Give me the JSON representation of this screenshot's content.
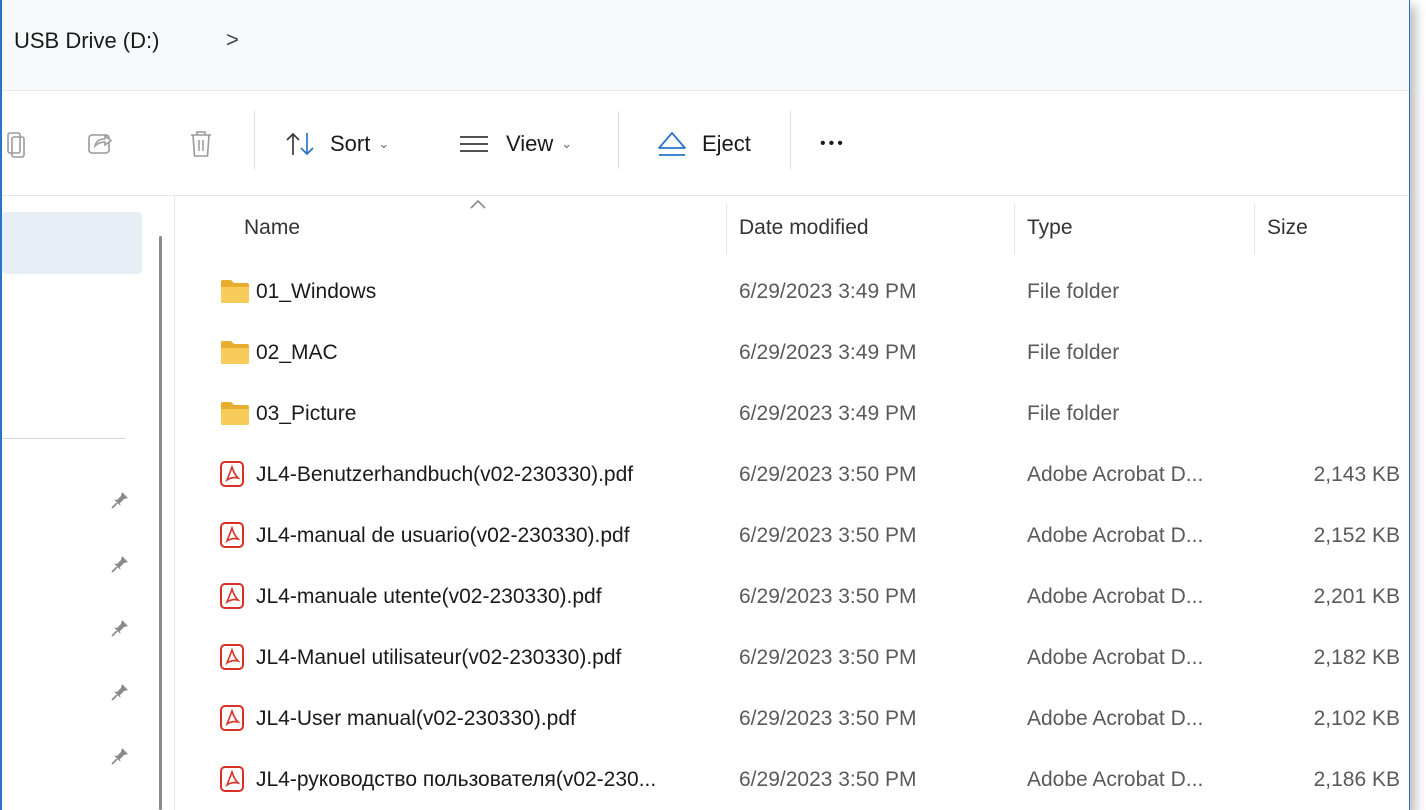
{
  "address": {
    "path": "USB Drive (D:)",
    "chevron": ">"
  },
  "toolbar": {
    "sort_label": "Sort",
    "view_label": "View",
    "eject_label": "Eject",
    "more_label": "•••"
  },
  "columns": {
    "name": "Name",
    "date": "Date modified",
    "type": "Type",
    "size": "Size"
  },
  "files": [
    {
      "name": "01_Windows",
      "date": "6/29/2023 3:49 PM",
      "type": "File folder",
      "size": "",
      "kind": "folder"
    },
    {
      "name": "02_MAC",
      "date": "6/29/2023 3:49 PM",
      "type": "File folder",
      "size": "",
      "kind": "folder"
    },
    {
      "name": "03_Picture",
      "date": "6/29/2023 3:49 PM",
      "type": "File folder",
      "size": "",
      "kind": "folder"
    },
    {
      "name": "JL4-Benutzerhandbuch(v02-230330).pdf",
      "date": "6/29/2023 3:50 PM",
      "type": "Adobe Acrobat D...",
      "size": "2,143 KB",
      "kind": "pdf"
    },
    {
      "name": "JL4-manual de usuario(v02-230330).pdf",
      "date": "6/29/2023 3:50 PM",
      "type": "Adobe Acrobat D...",
      "size": "2,152 KB",
      "kind": "pdf"
    },
    {
      "name": "JL4-manuale utente(v02-230330).pdf",
      "date": "6/29/2023 3:50 PM",
      "type": "Adobe Acrobat D...",
      "size": "2,201 KB",
      "kind": "pdf"
    },
    {
      "name": "JL4-Manuel utilisateur(v02-230330).pdf",
      "date": "6/29/2023 3:50 PM",
      "type": "Adobe Acrobat D...",
      "size": "2,182 KB",
      "kind": "pdf"
    },
    {
      "name": "JL4-User manual(v02-230330).pdf",
      "date": "6/29/2023 3:50 PM",
      "type": "Adobe Acrobat D...",
      "size": "2,102 KB",
      "kind": "pdf"
    },
    {
      "name": "JL4-руководство пользователя(v02-230...",
      "date": "6/29/2023 3:50 PM",
      "type": "Adobe Acrobat D...",
      "size": "2,186 KB",
      "kind": "pdf"
    }
  ],
  "icons": {
    "folder": "folder-icon",
    "pdf": "pdf-icon",
    "pin": "pin-icon"
  },
  "colors": {
    "accent": "#2b73c8",
    "folder": "#f2c14e",
    "pdf": "#d93025",
    "selection": "#e8eef6"
  }
}
